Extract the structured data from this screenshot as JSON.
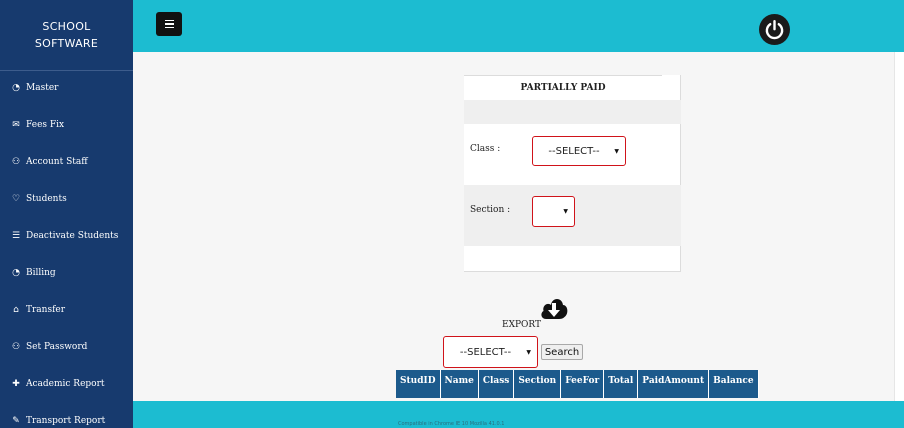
{
  "brand": {
    "line1": "SCHOOL",
    "line2": "SOFTWARE"
  },
  "sidebar": {
    "items": [
      {
        "label": "Master",
        "icon": "dashboard-icon",
        "glyph": "◔"
      },
      {
        "label": "Fees Fix",
        "icon": "envelope-icon",
        "glyph": "✉"
      },
      {
        "label": "Account Staff",
        "icon": "users-icon",
        "glyph": "⚇"
      },
      {
        "label": "Students",
        "icon": "heart-icon",
        "glyph": "♡"
      },
      {
        "label": "Deactivate Students",
        "icon": "list-icon",
        "glyph": "☰"
      },
      {
        "label": "Billing",
        "icon": "dashboard-icon",
        "glyph": "◔"
      },
      {
        "label": "Transfer",
        "icon": "home-icon",
        "glyph": "⌂"
      },
      {
        "label": "Set Password",
        "icon": "users-icon",
        "glyph": "⚇"
      },
      {
        "label": "Academic Report",
        "icon": "pin-icon",
        "glyph": "✚"
      },
      {
        "label": "Transport Report",
        "icon": "pencil-icon",
        "glyph": "✎"
      }
    ]
  },
  "topbar": {
    "menu_icon": "hamburger-menu-icon",
    "power_icon": "power-icon"
  },
  "panel": {
    "title": "PARTIALLY PAID",
    "class_label": "Class :",
    "class_select_value": "--SELECT--",
    "section_label": "Section :",
    "section_select_value": ""
  },
  "export": {
    "label": "EXPORT",
    "icon": "cloud-download-icon"
  },
  "search": {
    "select_value": "--SELECT--",
    "button_label": "Search"
  },
  "table": {
    "columns": [
      "StudID",
      "Name",
      "Class",
      "Section",
      "FeeFor",
      "Total",
      "PaidAmount",
      "Balance"
    ],
    "rows": []
  },
  "footer": {
    "text": "Compatible in Chrome IE 10 Mozilla 41.0.1"
  },
  "colors": {
    "sidebar": "#173a6e",
    "topbar": "#1cbcd1",
    "table_header": "#1c5a8c",
    "select_border": "#d0131a"
  }
}
